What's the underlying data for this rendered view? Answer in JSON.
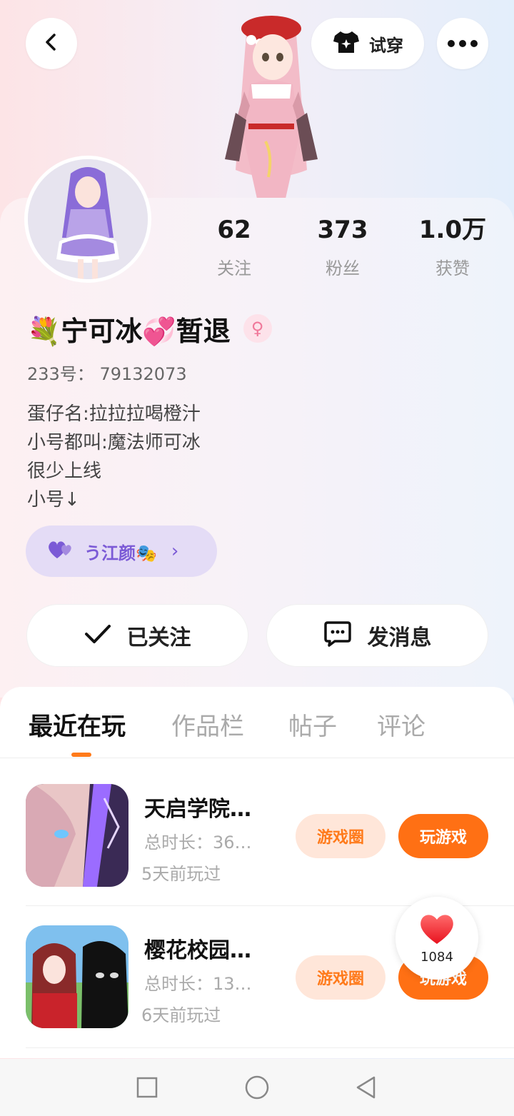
{
  "header": {
    "back_icon": "chevron-left-icon",
    "tryon_label": "试穿",
    "tryon_icon": "tshirt-icon",
    "more_icon": "more-icon"
  },
  "profile": {
    "stats": [
      {
        "value": "62",
        "label": "关注"
      },
      {
        "value": "373",
        "label": "粉丝"
      },
      {
        "value": "1.0万",
        "label": "获赞"
      }
    ],
    "nickname": "💐宁可冰💞暂退",
    "gender_symbol": "♀",
    "uid_label": "233号：",
    "uid_value": "79132073",
    "bio_lines": [
      "蛋仔名:拉拉拉喝橙汁",
      "小号都叫:魔法师可冰",
      "很少上线",
      "小号↓"
    ],
    "guild_name": "う江颜🎭",
    "guild_chevron": "›",
    "follow_label": "已关注",
    "message_label": "发消息"
  },
  "tabs": [
    {
      "label": "最近在玩",
      "active": true
    },
    {
      "label": "作品栏",
      "active": false
    },
    {
      "label": "帖子",
      "active": false
    },
    {
      "label": "评论",
      "active": false
    }
  ],
  "games": [
    {
      "title": "天启学院…",
      "duration": "总时长：36…",
      "last_played": "5天前玩过",
      "circle_label": "游戏圈",
      "play_label": "玩游戏"
    },
    {
      "title": "樱花校园…",
      "duration": "总时长：13…",
      "last_played": "6天前玩过",
      "circle_label": "游戏圈",
      "play_label": "玩游戏"
    }
  ],
  "like_count": "1084",
  "colors": {
    "accent_orange": "#ff7014",
    "light_orange": "#ffe6d9",
    "guild_purple": "#7b5ad6",
    "guild_bg": "#e4dcf6"
  }
}
